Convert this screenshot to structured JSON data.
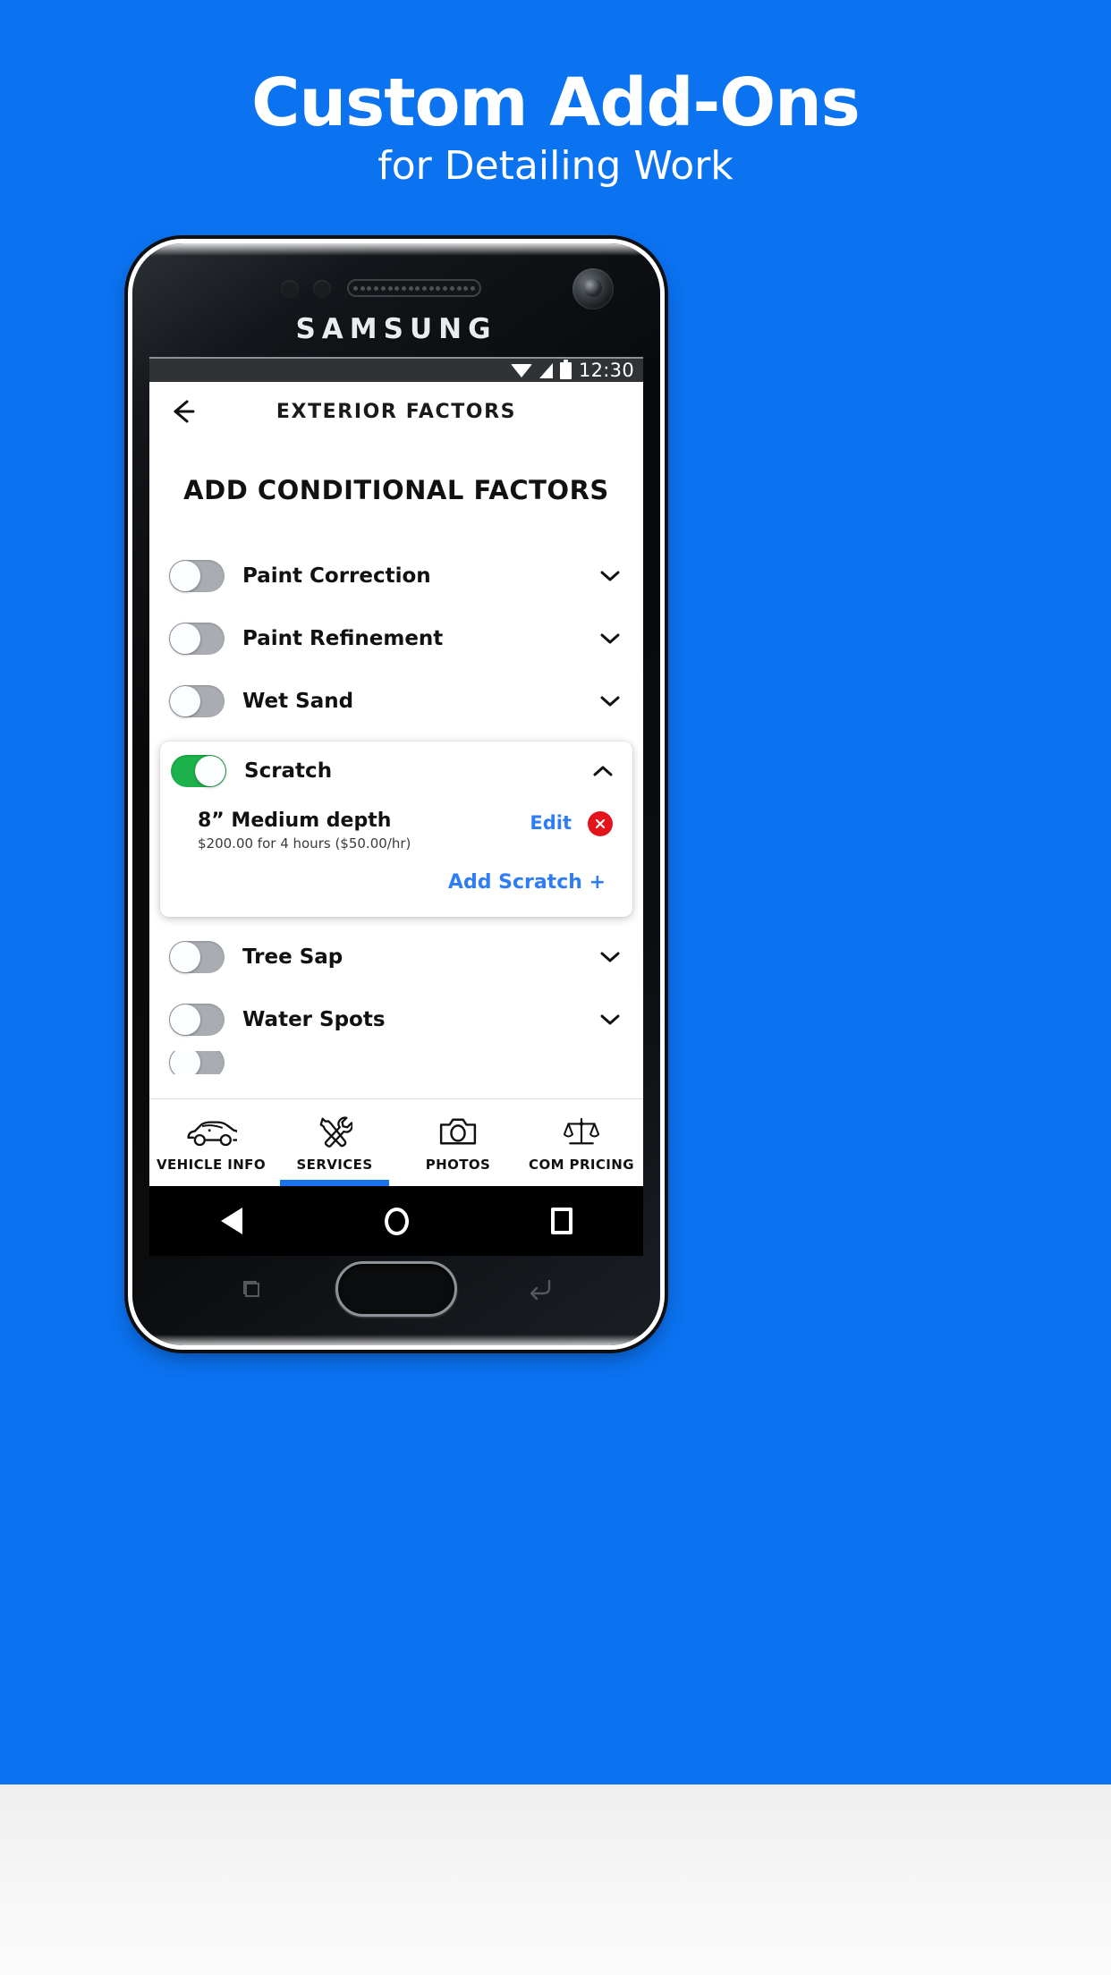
{
  "promo": {
    "headline": "Custom Add-Ons",
    "subhead": "for Detailing Work",
    "bg_color": "#0b72f0"
  },
  "device": {
    "brand": "SAMSUNG"
  },
  "status_bar": {
    "time": "12:30",
    "icons": [
      "wifi-icon",
      "signal-icon",
      "battery-icon"
    ]
  },
  "app": {
    "appbar": {
      "back_icon": "arrow-left-icon",
      "title": "EXTERIOR FACTORS"
    },
    "section_title": "ADD CONDITIONAL FACTORS",
    "factors": [
      {
        "label": "Paint Correction",
        "enabled": false,
        "expanded": false
      },
      {
        "label": "Paint Refinement",
        "enabled": false,
        "expanded": false
      },
      {
        "label": "Wet Sand",
        "enabled": false,
        "expanded": false
      },
      {
        "label": "Scratch",
        "enabled": true,
        "expanded": true
      },
      {
        "label": "Tree Sap",
        "enabled": false,
        "expanded": false
      },
      {
        "label": "Water Spots",
        "enabled": false,
        "expanded": false
      }
    ],
    "scratch_card": {
      "toggle_label": "Scratch",
      "collapse_icon": "chevron-up-icon",
      "item_title": "8” Medium depth",
      "item_price": "$200.00 for 4 hours ($50.00/hr)",
      "edit_label": "Edit",
      "delete_icon": "close-circle-icon",
      "add_label": "Add Scratch +",
      "link_color": "#2f7df6",
      "delete_color": "#e3141c",
      "toggle_on_color": "#1db14b"
    },
    "tabs": [
      {
        "label": "VEHICLE INFO",
        "icon": "car-icon",
        "active": false
      },
      {
        "label": "SERVICES",
        "icon": "tools-icon",
        "active": true
      },
      {
        "label": "PHOTOS",
        "icon": "camera-icon",
        "active": false
      },
      {
        "label": "COM PRICING",
        "icon": "scales-icon",
        "active": false
      }
    ],
    "active_tab_color": "#1a73f0"
  },
  "android_nav": {
    "back": "triangle-back-icon",
    "home": "circle-home-icon",
    "recents": "square-recents-icon"
  },
  "hardware": {
    "home_button": "home-button",
    "soft_recents": "soft-recents-icon",
    "soft_back": "soft-back-icon"
  }
}
